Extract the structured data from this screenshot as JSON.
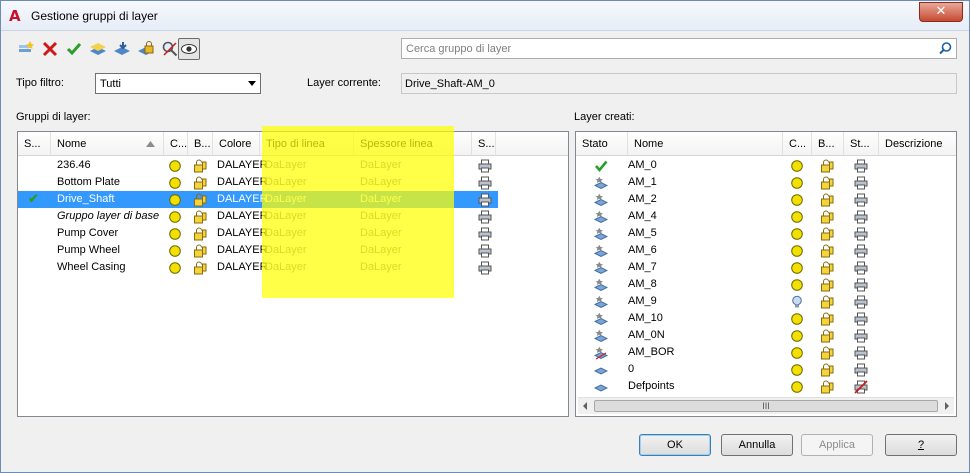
{
  "window": {
    "title": "Gestione gruppi di layer",
    "app_icon": "A",
    "close_glyph": "✕"
  },
  "search": {
    "placeholder": "Cerca gruppo di layer",
    "value": ""
  },
  "filter": {
    "label": "Tipo filtro:",
    "value": "Tutti"
  },
  "current_layer": {
    "label": "Layer corrente:",
    "value": "Drive_Shaft-AM_0"
  },
  "groups_panel": {
    "title": "Gruppi di layer:",
    "columns": [
      "S...",
      "Nome",
      "C...",
      "B...",
      "Colore",
      "Tipo di linea",
      "Spessore linea",
      "S..."
    ],
    "rows": [
      {
        "status": "",
        "name": "236.46",
        "color": "DALAYER",
        "linetype": "DaLayer",
        "lineweight": "DaLayer",
        "italic": false,
        "selected": false
      },
      {
        "status": "",
        "name": "Bottom Plate",
        "color": "DALAYER",
        "linetype": "DaLayer",
        "lineweight": "DaLayer",
        "italic": false,
        "selected": false
      },
      {
        "status": "✔",
        "name": "Drive_Shaft",
        "color": "DALAYER",
        "linetype": "DaLayer",
        "lineweight": "DaLayer",
        "italic": false,
        "selected": true
      },
      {
        "status": "",
        "name": "Gruppo layer di base",
        "color": "DALAYER",
        "linetype": "DaLayer",
        "lineweight": "DaLayer",
        "italic": true,
        "selected": false
      },
      {
        "status": "",
        "name": "Pump Cover",
        "color": "DALAYER",
        "linetype": "DaLayer",
        "lineweight": "DaLayer",
        "italic": false,
        "selected": false
      },
      {
        "status": "",
        "name": "Pump Wheel",
        "color": "DALAYER",
        "linetype": "DaLayer",
        "lineweight": "DaLayer",
        "italic": false,
        "selected": false
      },
      {
        "status": "",
        "name": "Wheel Casing",
        "color": "DALAYER",
        "linetype": "DaLayer",
        "lineweight": "DaLayer",
        "italic": false,
        "selected": false
      }
    ]
  },
  "layers_panel": {
    "title": "Layer creati:",
    "columns": [
      "Stato",
      "Nome",
      "C...",
      "B...",
      "St...",
      "Descrizione"
    ],
    "scroll_grip": "III",
    "rows": [
      {
        "state": "current",
        "name": "AM_0",
        "light": "on",
        "plot": "on"
      },
      {
        "state": "layer",
        "name": "AM_1",
        "light": "on",
        "plot": "on"
      },
      {
        "state": "layer",
        "name": "AM_2",
        "light": "on",
        "plot": "on"
      },
      {
        "state": "layer",
        "name": "AM_4",
        "light": "on",
        "plot": "on"
      },
      {
        "state": "layer",
        "name": "AM_5",
        "light": "on",
        "plot": "on"
      },
      {
        "state": "layer",
        "name": "AM_6",
        "light": "on",
        "plot": "on"
      },
      {
        "state": "layer",
        "name": "AM_7",
        "light": "on",
        "plot": "on"
      },
      {
        "state": "layer",
        "name": "AM_8",
        "light": "on",
        "plot": "on"
      },
      {
        "state": "layer",
        "name": "AM_9",
        "light": "off",
        "plot": "on"
      },
      {
        "state": "layer",
        "name": "AM_10",
        "light": "on",
        "plot": "on"
      },
      {
        "state": "layer",
        "name": "AM_0N",
        "light": "on",
        "plot": "on"
      },
      {
        "state": "layer-bor",
        "name": "AM_BOR",
        "light": "on",
        "plot": "on"
      },
      {
        "state": "plain",
        "name": "0",
        "light": "on",
        "plot": "on"
      },
      {
        "state": "plain",
        "name": "Defpoints",
        "light": "on",
        "plot": "off"
      }
    ]
  },
  "buttons": {
    "ok": "OK",
    "cancel": "Annulla",
    "apply": "Applica",
    "help": "?"
  },
  "colors": {
    "selection": "#3399ff",
    "highlight": "#ffff00",
    "lightbulb": "#f3e000"
  }
}
